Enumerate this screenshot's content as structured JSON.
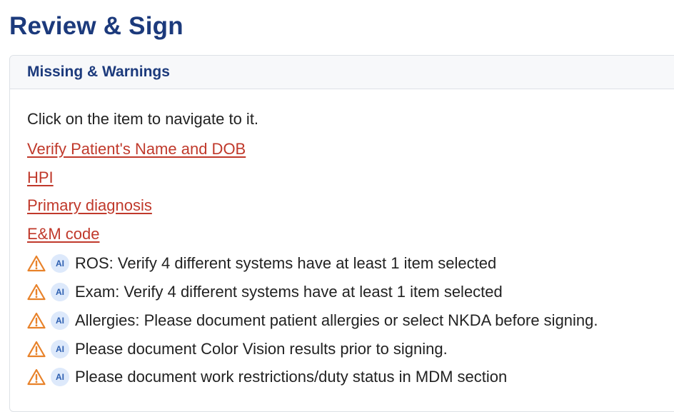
{
  "page": {
    "title": "Review & Sign"
  },
  "missing_warnings": {
    "title": "Missing & Warnings",
    "instruction": "Click on the item to navigate to it.",
    "missing_items": [
      {
        "label": "Verify Patient's Name and DOB"
      },
      {
        "label": "HPI"
      },
      {
        "label": "Primary diagnosis"
      },
      {
        "label": "E&M code"
      }
    ],
    "warnings": [
      {
        "badge": "AI",
        "text": "ROS: Verify 4 different systems have at least 1 item selected"
      },
      {
        "badge": "AI",
        "text": "Exam: Verify 4 different systems have at least 1 item selected"
      },
      {
        "badge": "AI",
        "text": "Allergies: Please document patient allergies or select NKDA before signing."
      },
      {
        "badge": "AI",
        "text": "Please document Color Vision results prior to signing."
      },
      {
        "badge": "AI",
        "text": "Please document work restrictions/duty status in MDM section"
      }
    ]
  },
  "icons": {
    "warning": "warning-triangle-icon",
    "ai": "ai-badge-icon"
  },
  "colors": {
    "title": "#1c3a7c",
    "link": "#c0392b",
    "warning": "#e8822a",
    "ai_badge_bg": "#dde9fb",
    "ai_badge_text": "#2d5fb0"
  }
}
